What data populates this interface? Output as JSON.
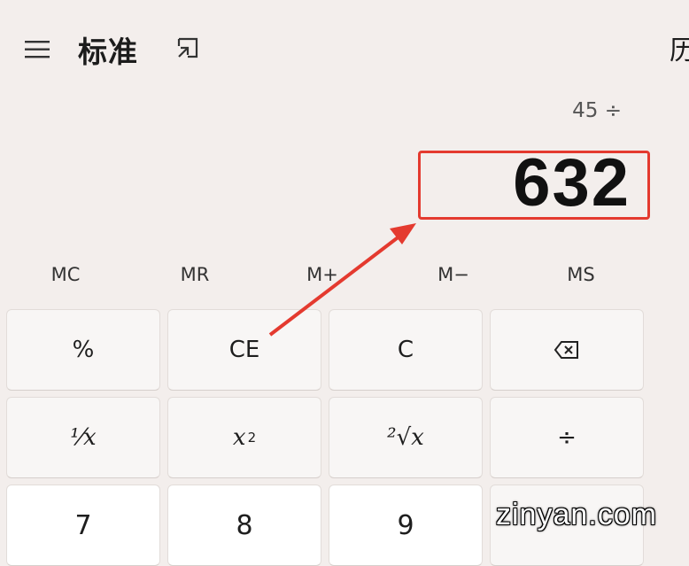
{
  "header": {
    "title": "标准",
    "history_label": "历"
  },
  "display": {
    "expression": "45 ÷",
    "result": "632",
    "highlight_color": "#e43a2f"
  },
  "memory": [
    "MC",
    "MR",
    "M+",
    "M−",
    "MS"
  ],
  "keys": {
    "percent": "%",
    "ce": "CE",
    "c": "C",
    "reciprocal": "⅟x",
    "square_base": "x",
    "square_exp": "2",
    "sqrt": "²√x",
    "divide": "÷",
    "seven": "7",
    "eight": "8",
    "nine": "9"
  },
  "icons": {
    "menu": "hamburger-menu-icon",
    "keep_on_top": "keep-on-top-icon",
    "backspace": "backspace-icon"
  },
  "watermark": "zinyan.com"
}
